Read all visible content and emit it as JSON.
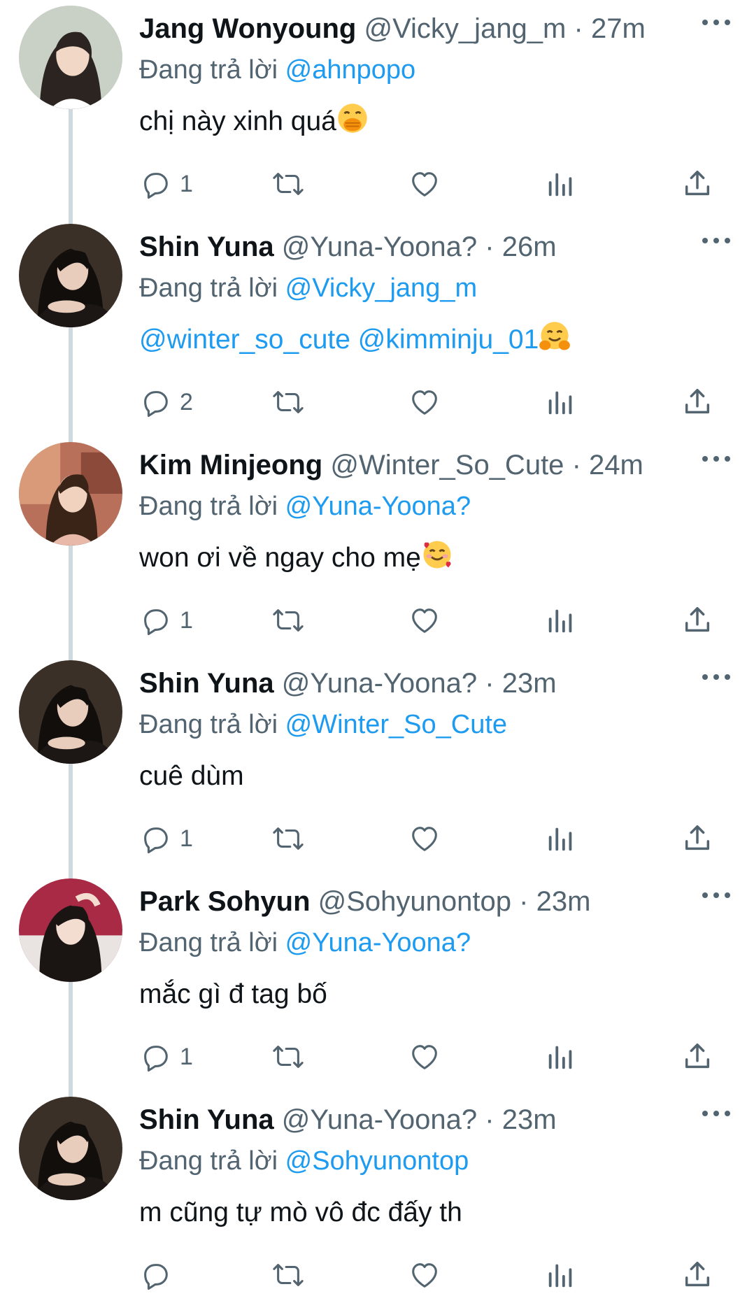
{
  "reply_prefix": "Đang trả lời",
  "colors": {
    "text": "#0f1419",
    "secondary": "#536471",
    "accent": "#1d9bf0",
    "thread_line": "#cfd9de"
  },
  "tweets": [
    {
      "name": "Jang Wonyoung",
      "handle": "@Vicky_jang_m",
      "time": "27m",
      "reply_to": "@ahnpopo",
      "text": "chị này xinh quá",
      "emoji": "face-with-hand-over-mouth-icon",
      "mentions": [],
      "reply_count": "1"
    },
    {
      "name": "Shin Yuna",
      "handle": "@Yuna-Yoona?",
      "time": "26m",
      "reply_to": "@Vicky_jang_m",
      "text": "",
      "mentions": [
        "@winter_so_cute",
        "@kimminju_01"
      ],
      "emoji": "hugging-face-icon",
      "reply_count": "2"
    },
    {
      "name": "Kim Minjeong",
      "handle": "@Winter_So_Cute",
      "time": "24m",
      "reply_to": "@Yuna-Yoona?",
      "text": "won ơi về ngay cho mẹ",
      "emoji": "smiling-face-with-hearts-icon",
      "mentions": [],
      "reply_count": "1"
    },
    {
      "name": "Shin Yuna",
      "handle": "@Yuna-Yoona?",
      "time": "23m",
      "reply_to": "@Winter_So_Cute",
      "text": "cuê dùm",
      "emoji": "",
      "mentions": [],
      "reply_count": "1"
    },
    {
      "name": "Park Sohyun",
      "handle": "@Sohyunontop",
      "time": "23m",
      "reply_to": "@Yuna-Yoona?",
      "text": "mắc gì đ tag bố",
      "emoji": "",
      "mentions": [],
      "reply_count": "1"
    },
    {
      "name": "Shin Yuna",
      "handle": "@Yuna-Yoona?",
      "time": "23m",
      "reply_to": "@Sohyunontop",
      "text": "m cũng tự mò vô đc đấy th",
      "emoji": "",
      "mentions": [],
      "reply_count": ""
    }
  ]
}
